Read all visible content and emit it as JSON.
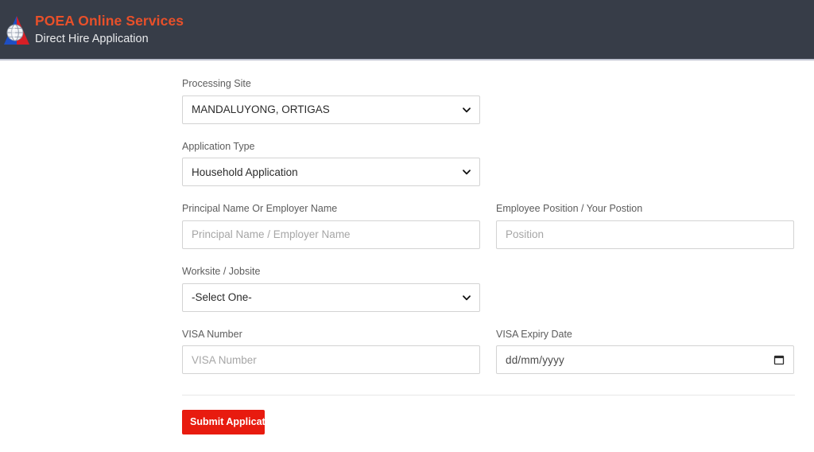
{
  "header": {
    "logo_icon": "poea-triangle-globe-logo",
    "title": "POEA Online Services",
    "subtitle": "Direct Hire Application",
    "bg_color": "#373d48",
    "title_color": "#e8502a"
  },
  "form": {
    "fields": {
      "processing_site": {
        "label": "Processing Site",
        "value": "MANDALUYONG, ORTIGAS",
        "type": "select"
      },
      "application_type": {
        "label": "Application Type",
        "value": "Household Application",
        "type": "select"
      },
      "principal_name": {
        "label": "Principal Name Or Employer Name",
        "value": "",
        "placeholder": "Principal Name / Employer Name",
        "type": "text"
      },
      "employee_position": {
        "label": "Employee Position / Your Postion",
        "value": "",
        "placeholder": "Position",
        "type": "text"
      },
      "worksite": {
        "label": "Worksite / Jobsite",
        "value": "-Select One-",
        "type": "select"
      },
      "visa_number": {
        "label": "VISA Number",
        "value": "",
        "placeholder": "VISA Number",
        "type": "text"
      },
      "visa_expiry": {
        "label": "VISA Expiry Date",
        "value": "dd/mm/yyyy",
        "type": "date",
        "icon": "calendar-icon"
      }
    },
    "submit_label": "Submit Application",
    "submit_color": "#e81b0f"
  }
}
